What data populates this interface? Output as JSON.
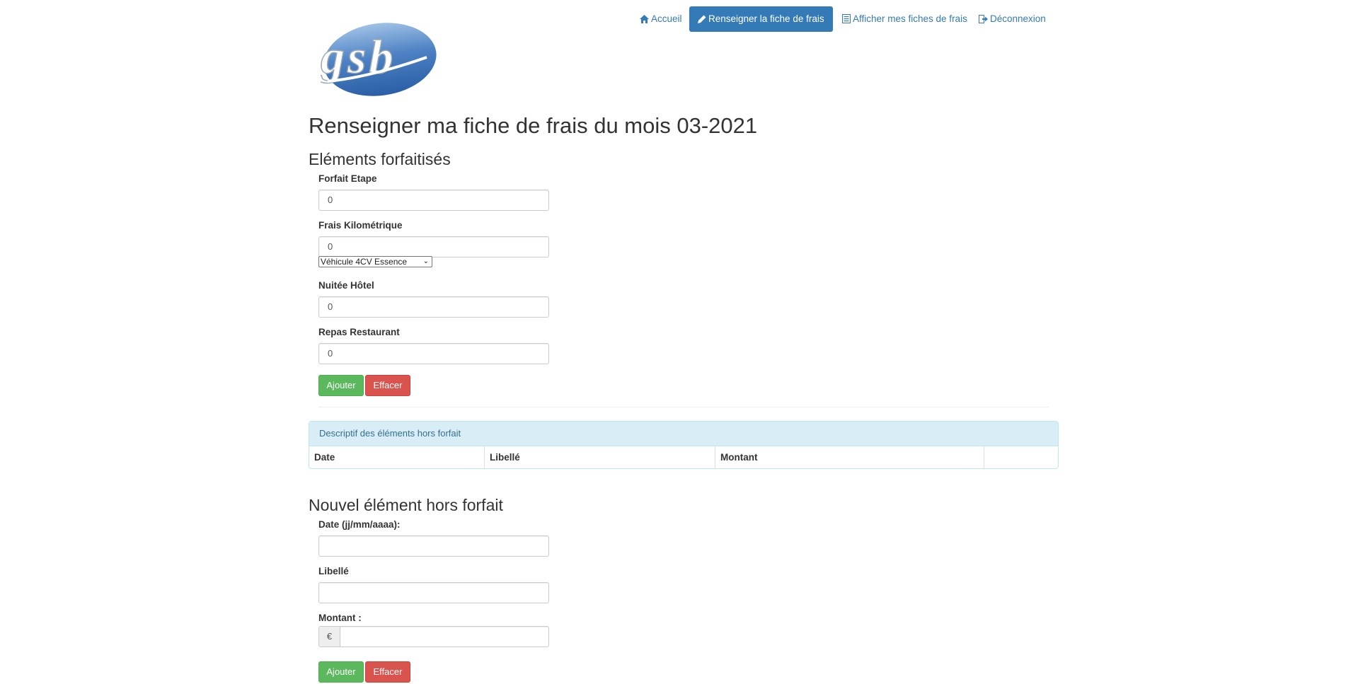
{
  "nav": {
    "items": [
      {
        "label": "Accueil",
        "icon": "home-icon"
      },
      {
        "label": "Renseigner la fiche de frais",
        "icon": "pencil-icon",
        "active": true
      },
      {
        "label": "Afficher mes fiches de frais",
        "icon": "list-icon"
      },
      {
        "label": "Déconnexion",
        "icon": "logout-icon"
      }
    ],
    "accent_color": "#337ab7"
  },
  "logo": {
    "text": "gsb"
  },
  "page_title": "Renseigner ma fiche de frais du mois 03-2021",
  "forfait": {
    "title": "Eléments forfaitisés",
    "fields": [
      {
        "label": "Forfait Etape",
        "value": "0"
      },
      {
        "label": "Frais Kilométrique",
        "value": "0"
      },
      {
        "label": "Nuitée Hôtel",
        "value": "0"
      },
      {
        "label": "Repas Restaurant",
        "value": "0"
      }
    ],
    "vehicle_select": "Véhicule 4CV Essence",
    "add_label": "Ajouter",
    "clear_label": "Effacer"
  },
  "hors_forfait_table": {
    "heading": "Descriptif des éléments hors forfait",
    "columns": [
      "Date",
      "Libellé",
      "Montant",
      ""
    ]
  },
  "new_element": {
    "title": "Nouvel élément hors forfait",
    "date_label": "Date (jj/mm/aaaa):",
    "libelle_label": "Libellé",
    "montant_label": "Montant :",
    "currency": "€",
    "add_label": "Ajouter",
    "clear_label": "Effacer"
  }
}
